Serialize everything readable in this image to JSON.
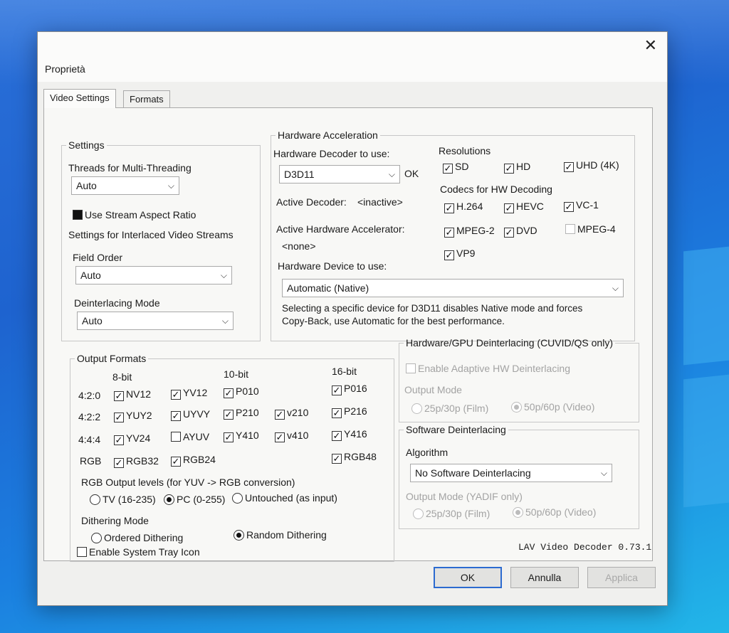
{
  "dialog": {
    "title": "Proprietà",
    "close_glyph": "✕",
    "version": "LAV Video Decoder 0.73.1",
    "tabs": [
      {
        "label": "Video Settings"
      },
      {
        "label": "Formats"
      }
    ],
    "buttons": {
      "ok": "OK",
      "cancel": "Annulla",
      "apply": "Applica"
    }
  },
  "settings": {
    "legend": "Settings",
    "threads_label": "Threads for Multi-Threading",
    "threads_value": "Auto",
    "stream_aspect_label": "Use Stream Aspect Ratio",
    "interlaced_label": "Settings for Interlaced Video Streams",
    "field_order_label": "Field Order",
    "field_order_value": "Auto",
    "deint_mode_label": "Deinterlacing Mode",
    "deint_mode_value": "Auto"
  },
  "hw": {
    "legend": "Hardware Acceleration",
    "decoder_label": "Hardware Decoder to use:",
    "decoder_value": "D3D11",
    "decoder_status": "OK",
    "active_decoder_label": "Active Decoder:",
    "active_decoder_value": "<inactive>",
    "active_accel_label": "Active Hardware Accelerator:",
    "active_accel_value": "<none>",
    "device_label": "Hardware Device to use:",
    "device_value": "Automatic (Native)",
    "note_line1": "Selecting a specific device for D3D11 disables Native mode and forces",
    "note_line2": "Copy-Back, use Automatic for the best performance.",
    "resolutions_label": "Resolutions",
    "resolutions": [
      {
        "label": "SD",
        "checked": true
      },
      {
        "label": "HD",
        "checked": true
      },
      {
        "label": "UHD (4K)",
        "checked": true
      }
    ],
    "codecs_label": "Codecs for HW Decoding",
    "codecs": [
      {
        "label": "H.264",
        "checked": true
      },
      {
        "label": "HEVC",
        "checked": true
      },
      {
        "label": "VC-1",
        "checked": true
      },
      {
        "label": "MPEG-2",
        "checked": true
      },
      {
        "label": "DVD",
        "checked": true
      },
      {
        "label": "MPEG-4",
        "checked": false
      },
      {
        "label": "VP9",
        "checked": true
      }
    ]
  },
  "output": {
    "legend": "Output Formats",
    "col_8bit": "8-bit",
    "col_10bit": "10-bit",
    "col_16bit": "16-bit",
    "row_420": "4:2:0",
    "row_422": "4:2:2",
    "row_444": "4:4:4",
    "row_rgb": "RGB",
    "formats": {
      "nv12": "NV12",
      "yv12": "YV12",
      "p010": "P010",
      "p016": "P016",
      "yuy2": "YUY2",
      "uyvy": "UYVY",
      "p210": "P210",
      "v210": "v210",
      "p216": "P216",
      "yv24": "YV24",
      "ayuv": "AYUV",
      "y410": "Y410",
      "v410": "v410",
      "y416": "Y416",
      "rgb32": "RGB32",
      "rgb24": "RGB24",
      "rgb48": "RGB48"
    },
    "rgb_levels_label": "RGB Output levels (for YUV -> RGB conversion)",
    "rgb_tv": "TV (16-235)",
    "rgb_pc": "PC (0-255)",
    "rgb_untouched": "Untouched (as input)",
    "dither_label": "Dithering Mode",
    "dither_ordered": "Ordered Dithering",
    "dither_random": "Random Dithering"
  },
  "hwdeint": {
    "legend": "Hardware/GPU Deinterlacing (CUVID/QS only)",
    "adaptive_label": "Enable Adaptive HW Deinterlacing",
    "output_mode_label": "Output Mode",
    "film": "25p/30p (Film)",
    "video": "50p/60p (Video)"
  },
  "swdeint": {
    "legend": "Software Deinterlacing",
    "algorithm_label": "Algorithm",
    "algorithm_value": "No Software Deinterlacing",
    "output_mode_label": "Output Mode (YADIF only)",
    "film": "25p/30p (Film)",
    "video": "50p/60p (Video)"
  },
  "tray": {
    "label": "Enable System Tray Icon"
  }
}
